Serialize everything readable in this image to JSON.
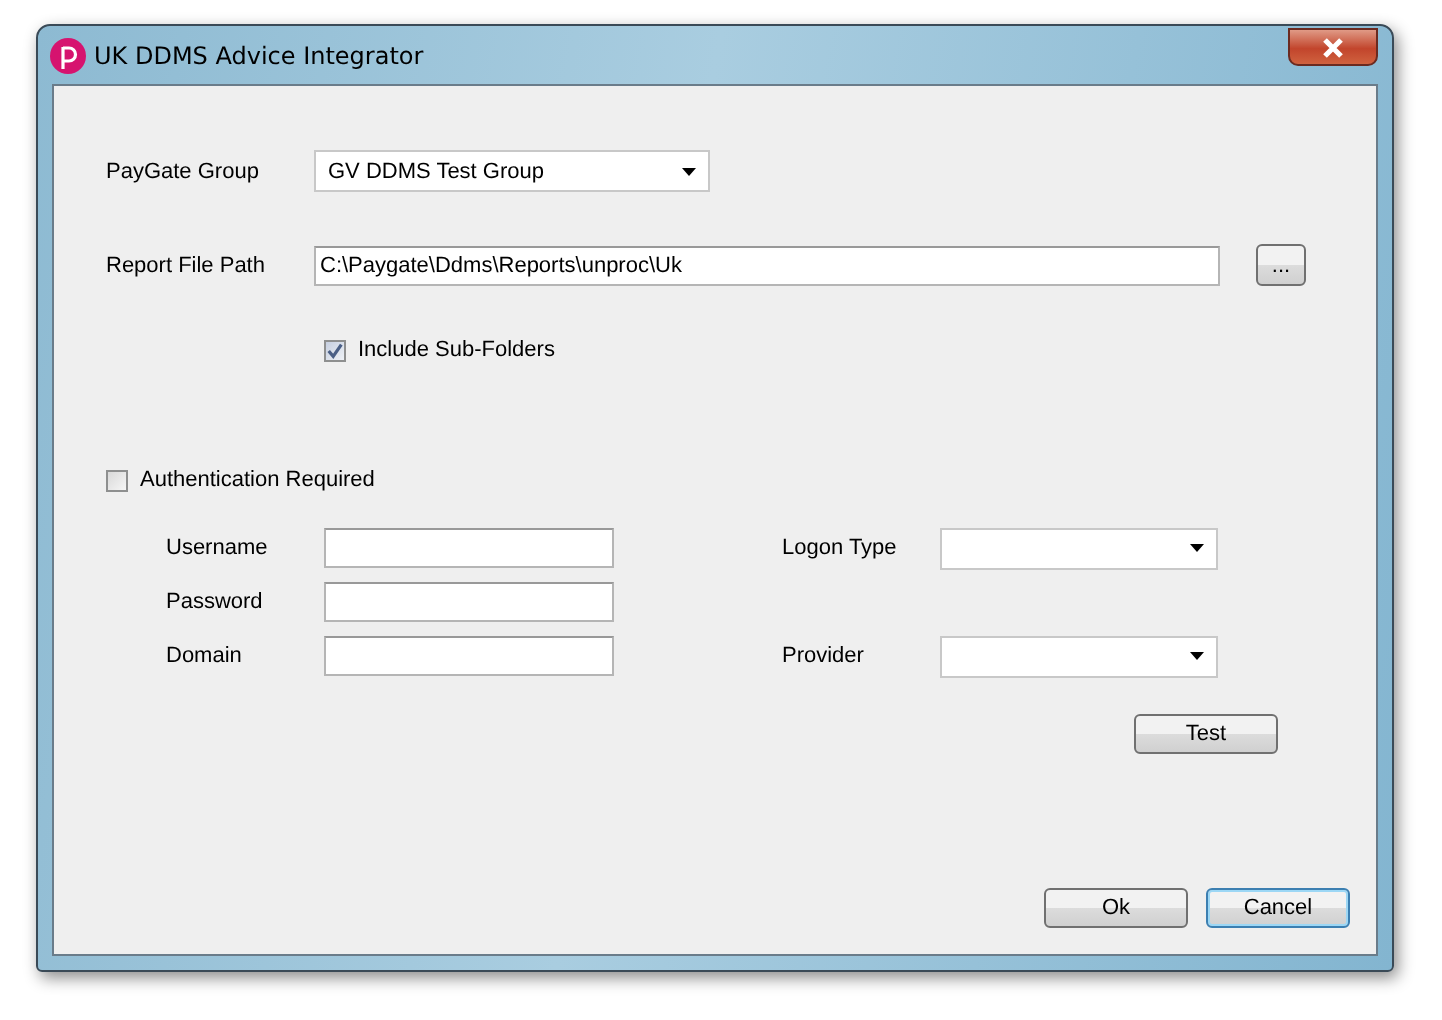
{
  "window": {
    "title": "UK DDMS Advice Integrator"
  },
  "paygate_group": {
    "label": "PayGate Group",
    "value": "GV DDMS Test Group"
  },
  "report_file_path": {
    "label": "Report File Path",
    "value": "C:\\Paygate\\Ddms\\Reports\\unproc\\Uk",
    "browse_button": "..."
  },
  "include_sub_folders": {
    "label": "Include Sub-Folders",
    "checked": true
  },
  "authentication_required": {
    "label": "Authentication Required",
    "checked": false
  },
  "credentials": [
    {
      "label": "Username"
    },
    {
      "label": "Password"
    },
    {
      "label": "Domain"
    }
  ],
  "logon_type": {
    "label": "Logon Type"
  },
  "provider": {
    "label": "Provider"
  },
  "test_button": "Test",
  "buttons": [
    {
      "label": "Ok",
      "default": false
    },
    {
      "label": "Cancel",
      "default": true
    }
  ]
}
